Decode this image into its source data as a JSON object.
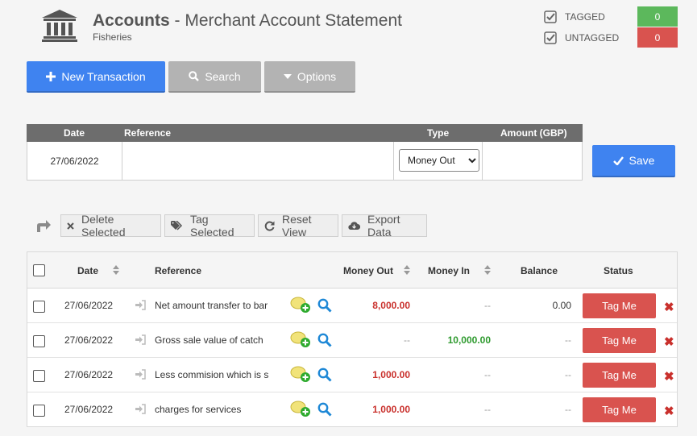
{
  "header": {
    "title_bold": "Accounts",
    "title_rest": " - Merchant Account Statement",
    "subtitle": "Fisheries"
  },
  "tag_summary": [
    {
      "label": "TAGGED",
      "count": "0",
      "color": "#5cb85c"
    },
    {
      "label": "UNTAGGED",
      "count": "0",
      "color": "#d9534f"
    }
  ],
  "actions": {
    "new_transaction": "New Transaction",
    "search": "Search",
    "options": "Options"
  },
  "entry": {
    "headers": {
      "date": "Date",
      "reference": "Reference",
      "type": "Type",
      "amount": "Amount (GBP)"
    },
    "date": "27/06/2022",
    "reference": "",
    "type_selected": "Money Out",
    "amount": "",
    "save": "Save"
  },
  "toolbar": {
    "delete": "Delete Selected",
    "tag": "Tag Selected",
    "reset": "Reset View",
    "export": "Export Data"
  },
  "table": {
    "headers": {
      "date": "Date",
      "reference": "Reference",
      "money_out": "Money Out",
      "money_in": "Money In",
      "balance": "Balance",
      "status": "Status"
    },
    "rows": [
      {
        "date": "27/06/2022",
        "reference": "Net amount transfer to bar",
        "money_out": "8,000.00",
        "money_in": "--",
        "balance": "0.00",
        "status": "Tag Me"
      },
      {
        "date": "27/06/2022",
        "reference": "Gross sale value of catch",
        "money_out": "--",
        "money_in": "10,000.00",
        "balance": "--",
        "status": "Tag Me"
      },
      {
        "date": "27/06/2022",
        "reference": "Less commision which is s",
        "money_out": "1,000.00",
        "money_in": "--",
        "balance": "--",
        "status": "Tag Me"
      },
      {
        "date": "27/06/2022",
        "reference": "charges for services",
        "money_out": "1,000.00",
        "money_in": "--",
        "balance": "--",
        "status": "Tag Me"
      }
    ]
  },
  "colors": {
    "primary": "#3f83f0",
    "money_out": "#c9302c",
    "money_in": "#2e9a2e",
    "tagged": "#5cb85c",
    "untagged": "#d9534f"
  }
}
